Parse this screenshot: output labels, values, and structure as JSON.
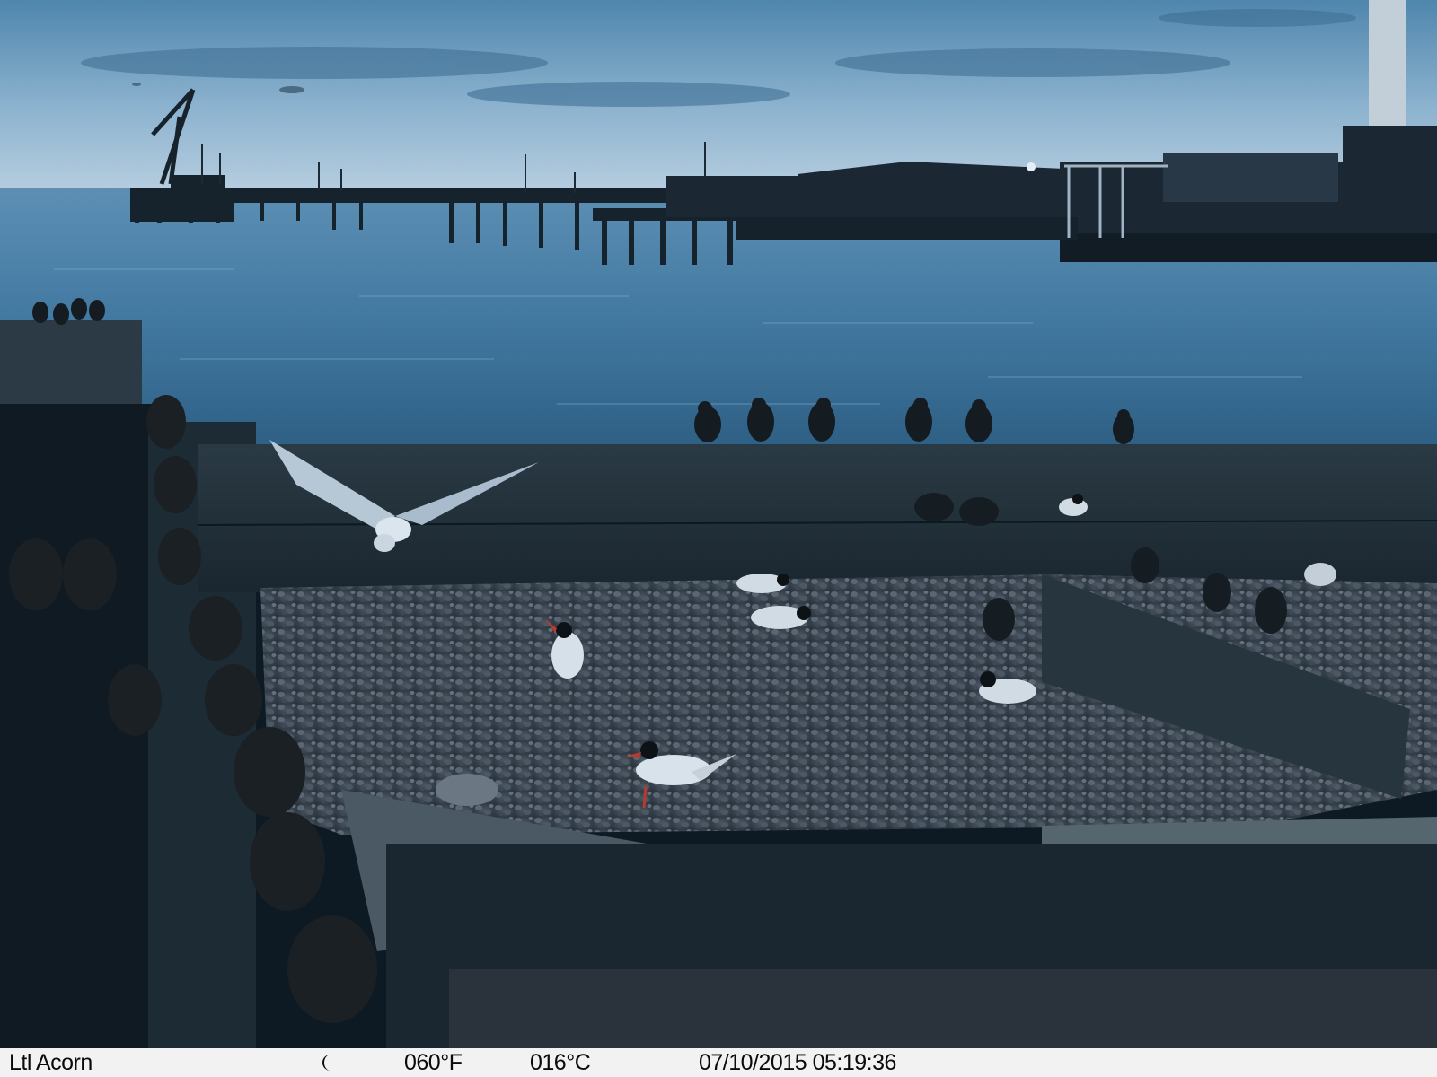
{
  "info_bar": {
    "camera_name": "Ltl Acorn",
    "moon_icon": "crescent-moon-icon",
    "temperature_f": "060°F",
    "temperature_c": "016°C",
    "date": "07/10/2015",
    "time": "05:19:36",
    "datetime": "07/10/2015 05:19:36"
  },
  "colors": {
    "sky": "#8fb3cf",
    "water": "#3a6f95",
    "gravel": "#3b4652",
    "info_bar_bg": "#f2f2f2",
    "info_bar_text": "#0b0b0b"
  }
}
